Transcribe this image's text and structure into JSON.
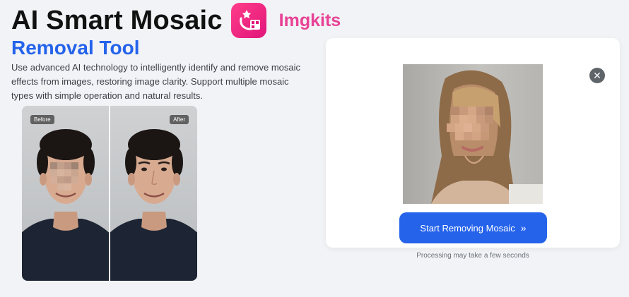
{
  "hero": {
    "title": "AI Smart Mosaic",
    "brand": "Imgkits",
    "subtitle": "Removal Tool",
    "description": "Use advanced AI technology to intelligently identify and remove mosaic effects from images, restoring image clarity. Support multiple mosaic types with simple operation and natural results."
  },
  "comparison": {
    "before_label": "Before",
    "after_label": "After"
  },
  "upload_card": {
    "close_icon": "x-icon",
    "start_button_label": "Start Removing Mosaic",
    "start_button_icon": "double-chevron-right-icon",
    "processing_note": "Processing may take a few seconds"
  },
  "colors": {
    "accent": "#2563eb",
    "brand": "#e84295",
    "background": "#f2f3f6"
  }
}
